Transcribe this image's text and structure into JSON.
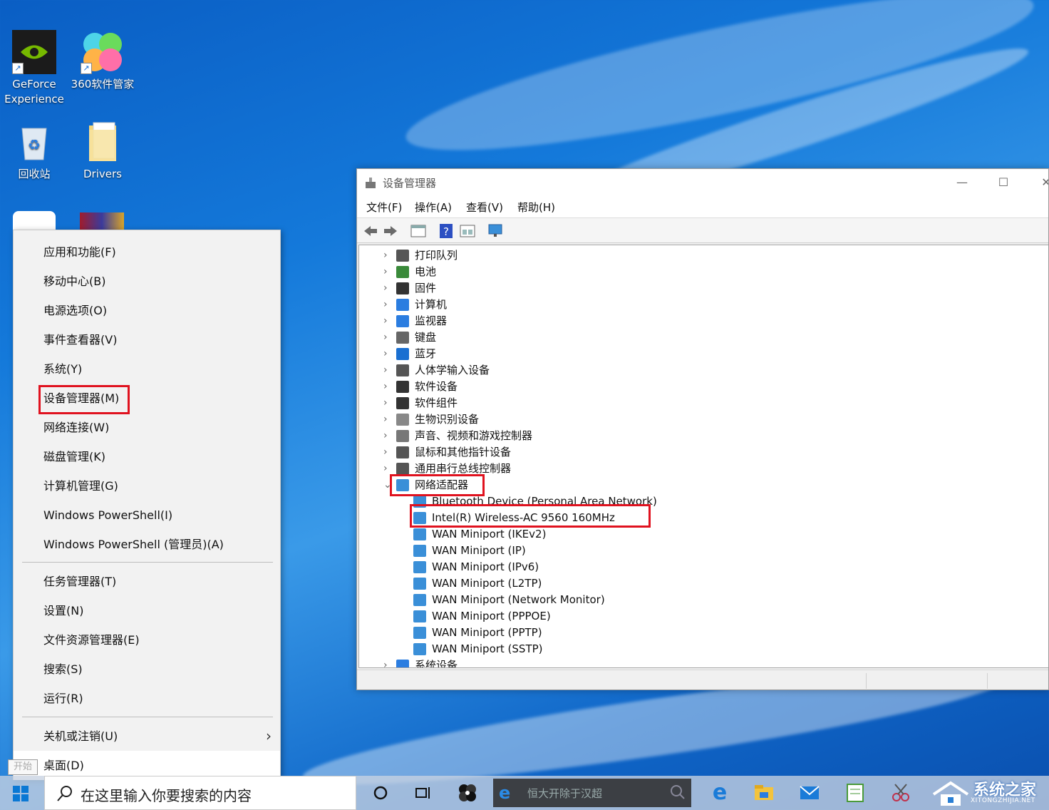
{
  "desktop": {
    "icons": [
      {
        "label": "GeForce Experience"
      },
      {
        "label": "360软件管家"
      },
      {
        "label": "回收站"
      },
      {
        "label": "Drivers"
      }
    ]
  },
  "winx_menu": {
    "group1": [
      "应用和功能(F)",
      "移动中心(B)",
      "电源选项(O)",
      "事件查看器(V)",
      "系统(Y)",
      "设备管理器(M)",
      "网络连接(W)",
      "磁盘管理(K)",
      "计算机管理(G)",
      "Windows PowerShell(I)",
      "Windows PowerShell (管理员)(A)"
    ],
    "group2": [
      "任务管理器(T)",
      "设置(N)",
      "文件资源管理器(E)",
      "搜索(S)",
      "运行(R)"
    ],
    "shutdown": "关机或注销(U)",
    "desktop": "桌面(D)",
    "start_tooltip": "开始"
  },
  "device_manager": {
    "title": "设备管理器",
    "menus": [
      "文件(F)",
      "操作(A)",
      "查看(V)",
      "帮助(H)"
    ],
    "categories": [
      "打印队列",
      "电池",
      "固件",
      "计算机",
      "监视器",
      "键盘",
      "蓝牙",
      "人体学输入设备",
      "软件设备",
      "软件组件",
      "生物识别设备",
      "声音、视频和游戏控制器",
      "鼠标和其他指针设备",
      "通用串行总线控制器"
    ],
    "expanded_category": "网络适配器",
    "network_adapters": [
      "Bluetooth Device (Personal Area Network)",
      "Intel(R) Wireless-AC 9560 160MHz",
      "WAN Miniport (IKEv2)",
      "WAN Miniport (IP)",
      "WAN Miniport (IPv6)",
      "WAN Miniport (L2TP)",
      "WAN Miniport (Network Monitor)",
      "WAN Miniport (PPPOE)",
      "WAN Miniport (PPTP)",
      "WAN Miniport (SSTP)"
    ],
    "last_category": "系统设备"
  },
  "taskbar": {
    "search_placeholder": "在这里输入你要搜索的内容",
    "ie_text": "恒大开除于汉超"
  },
  "watermark": {
    "text": "系统之家",
    "sub": "XITONGZHIJIA.NET"
  },
  "colors": {
    "highlight_box": "#e0121f",
    "accent": "#0078d7"
  }
}
